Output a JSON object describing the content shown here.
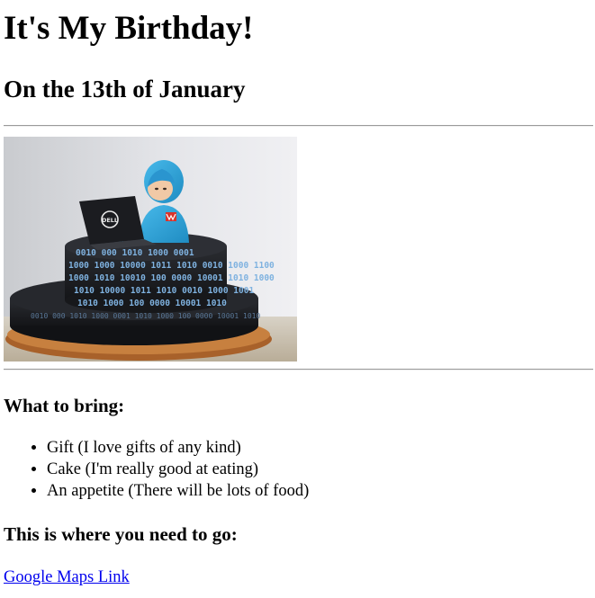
{
  "heading": {
    "title": "It's My Birthday!",
    "subtitle": "On the 13th of January"
  },
  "photo": {
    "alt": "Cake with a figure in a blue hoodie on a Dell laptop",
    "laptop_brand": "DELL",
    "binary_rows": [
      "0010 000 1010 1000 0001",
      "1000 1000 10000 1011 1010 0010 1000 1100",
      "1000 1010 10010 100 0000 10001 1010 1000",
      "1010 10000 1011 1010 0010 1000 1001",
      "1010 1000 100 0000 10001 1010"
    ],
    "colors": {
      "hoodie": "#2fa4d8",
      "cake": "#1d1e22",
      "board": "#c47a3a",
      "binary_text": "#7fb2e0"
    }
  },
  "bring": {
    "heading": "What to bring:",
    "items": [
      "Gift (I love gifts of any kind)",
      "Cake (I'm really good at eating)",
      "An appetite (There will be lots of food)"
    ]
  },
  "location": {
    "heading": "This is where you need to go:",
    "link_text": "Google Maps Link",
    "link_color": "#0000ee"
  }
}
